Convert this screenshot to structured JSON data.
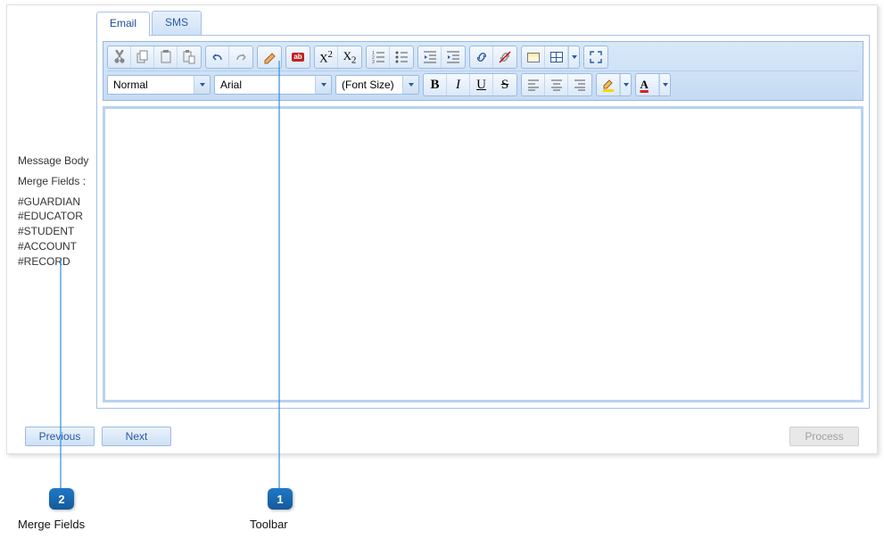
{
  "tabs": {
    "email": "Email",
    "sms": "SMS"
  },
  "sidebar": {
    "body_label": "Message Body",
    "merge_label": "Merge Fields :",
    "fields": [
      "#GUARDIAN",
      "#EDUCATOR",
      "#STUDENT",
      "#ACCOUNT",
      "#RECORD"
    ]
  },
  "toolbar": {
    "style": "Normal",
    "font": "Arial",
    "size": "(Font Size)",
    "bold": "B",
    "italic": "I",
    "underline": "U",
    "strike": "S",
    "superscript": "X",
    "superscript_sup": "2",
    "subscript": "X",
    "subscript_sub": "2",
    "spellcheck_label": "ab",
    "fontcolor_letter": "A"
  },
  "footer": {
    "previous": "Previous",
    "next": "Next",
    "process": "Process"
  },
  "callouts": {
    "one": "1",
    "two": "2",
    "toolbar_label": "Toolbar",
    "merge_label": "Merge Fields"
  }
}
